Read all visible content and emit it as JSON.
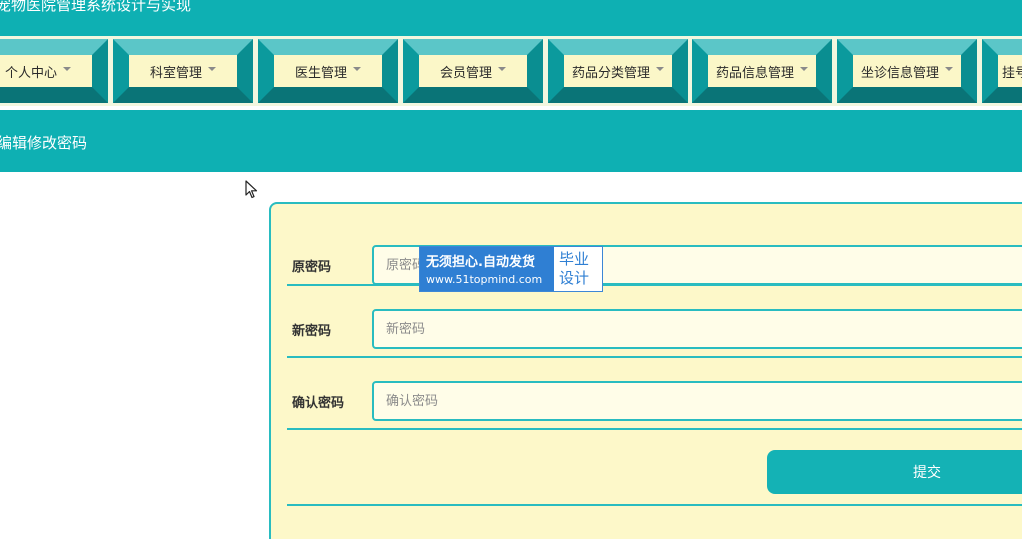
{
  "app": {
    "title": "宠物医院管理系统设计与实现"
  },
  "nav": {
    "items": [
      {
        "label": "个人中心"
      },
      {
        "label": "科室管理"
      },
      {
        "label": "医生管理"
      },
      {
        "label": "会员管理"
      },
      {
        "label": "药品分类管理"
      },
      {
        "label": "药品信息管理"
      },
      {
        "label": "坐诊信息管理"
      },
      {
        "label": "挂号"
      }
    ]
  },
  "section": {
    "title": "编辑修改密码"
  },
  "form": {
    "old_password": {
      "label": "原密码",
      "placeholder": "原密码"
    },
    "new_password": {
      "label": "新密码",
      "placeholder": "新密码"
    },
    "confirm_password": {
      "label": "确认密码",
      "placeholder": "确认密码"
    },
    "submit_label": "提交"
  },
  "watermark": {
    "line1": "无须担心.自动发货",
    "line2": "www.51topmind.com",
    "tag1": "毕业",
    "tag2": "设计"
  },
  "colors": {
    "header": "#0eb0b3",
    "panel": "#fdf8c9",
    "border": "#29bcc0",
    "button": "#14b2b5"
  },
  "icons": {
    "cursor": "mouse-pointer-icon",
    "nav_caret": "caret-down-icon"
  }
}
